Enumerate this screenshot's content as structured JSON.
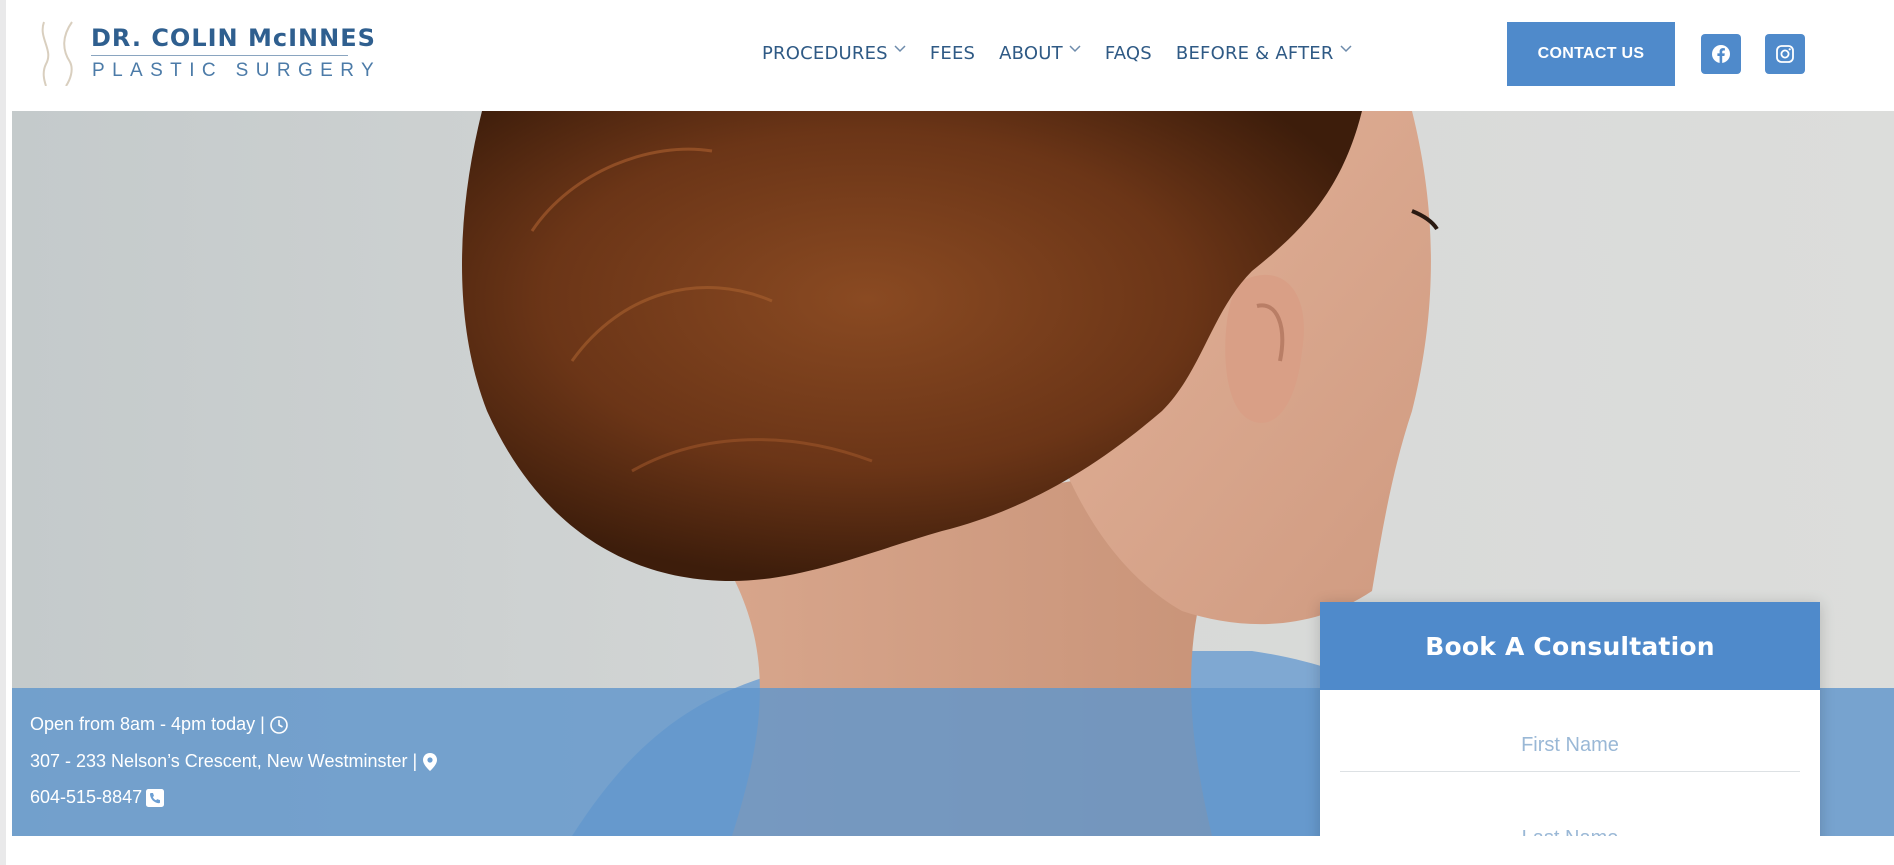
{
  "header": {
    "logo": {
      "name_line": "DR. COLIN McINNES",
      "subtitle_line": "PLASTIC SURGERY"
    },
    "nav": [
      {
        "label": "PROCEDURES",
        "has_dropdown": true
      },
      {
        "label": "FEES",
        "has_dropdown": false
      },
      {
        "label": "ABOUT",
        "has_dropdown": true
      },
      {
        "label": "FAQS",
        "has_dropdown": false
      },
      {
        "label": "BEFORE & AFTER",
        "has_dropdown": true
      }
    ],
    "contact_button": "CONTACT US",
    "social": [
      {
        "icon": "facebook-icon"
      },
      {
        "icon": "instagram-icon"
      }
    ]
  },
  "hero": {
    "info": {
      "hours": "Open from 8am - 4pm today |",
      "address": "307 - 233 Nelson’s Crescent, New Westminster |",
      "phone": "604-515-8847"
    }
  },
  "consultation": {
    "title": "Book A Consultation",
    "first_name_placeholder": "First Name",
    "last_name_placeholder": "Last Name"
  },
  "colors": {
    "brand_blue": "#4f8acb",
    "nav_text": "#2f5a85",
    "info_band": "#6096cc"
  }
}
